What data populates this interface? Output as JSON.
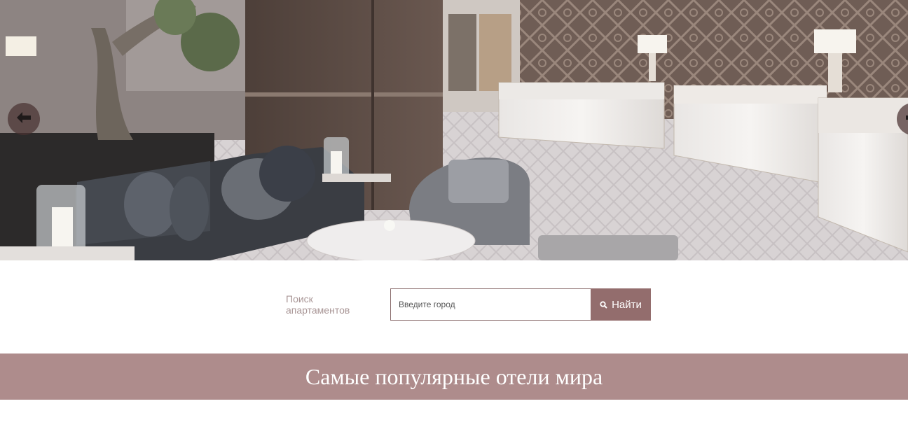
{
  "hero": {
    "prev_icon": "arrow-left-icon",
    "next_icon": "arrow-right-icon"
  },
  "search": {
    "label": "Поиск апартаментов",
    "placeholder": "Введите город",
    "button_label": "Найти",
    "button_icon": "search-icon"
  },
  "section": {
    "title": "Самые популярные отели мира"
  },
  "colors": {
    "accent": "#936d6d",
    "banner": "#ae8c8c",
    "label": "#a99696"
  }
}
